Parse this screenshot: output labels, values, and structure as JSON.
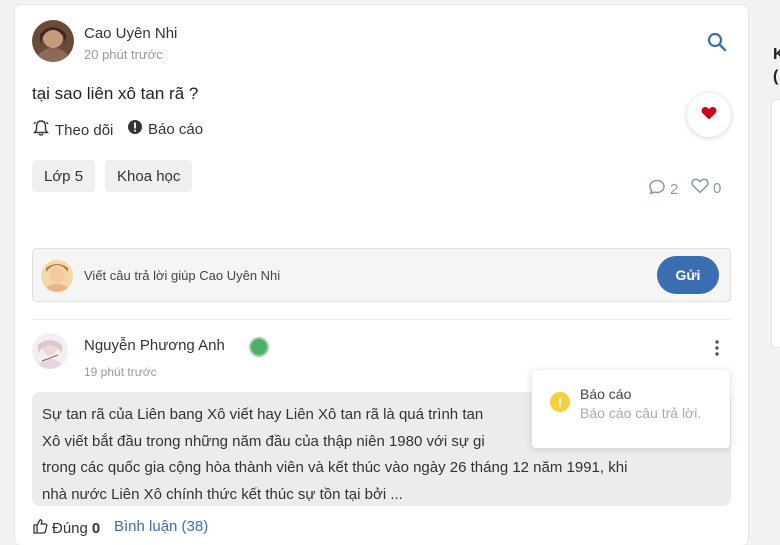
{
  "question_post": {
    "author": "Cao Uyên Nhi",
    "time": "20 phút trước",
    "text": "tại sao liên xô tan rã ?",
    "actions": {
      "follow": "Theo dõi",
      "report": "Báo cáo"
    },
    "tags": [
      "Lớp 5",
      "Khoa học"
    ],
    "comment_count": "2",
    "like_count": "0"
  },
  "reply_box": {
    "placeholder": "Viết câu trả lời giúp Cao Uyên Nhi",
    "send_label": "Gửi"
  },
  "answer": {
    "author": "Nguyễn Phương Anh",
    "time": "19 phút trước",
    "lines": [
      "Sự tan rã của Liên bang Xô viết hay Liên Xô tan rã là quá trình tan",
      "Xô viết bắt đầu trong những năm đầu của thập niên 1980 với sự gi",
      "trong các quốc gia cộng hòa thành viên và kết thúc vào ngày 26 tháng 12 năm 1991, khi",
      "nhà nước Liên Xô chính thức kết thúc sự tồn tại bởi ..."
    ],
    "correct_label": "Đúng",
    "correct_count": "0",
    "comments_label": "Bình luận (38)"
  },
  "report_popup": {
    "title": "Báo cáo",
    "subtitle": "Báo cáo câu trả lời."
  },
  "side_panel": {
    "line1": "K",
    "line2": "("
  },
  "colors": {
    "accent": "#3b6db3",
    "heart": "#d0021b",
    "online": "#4caf6a",
    "warning": "#f4d03f"
  }
}
